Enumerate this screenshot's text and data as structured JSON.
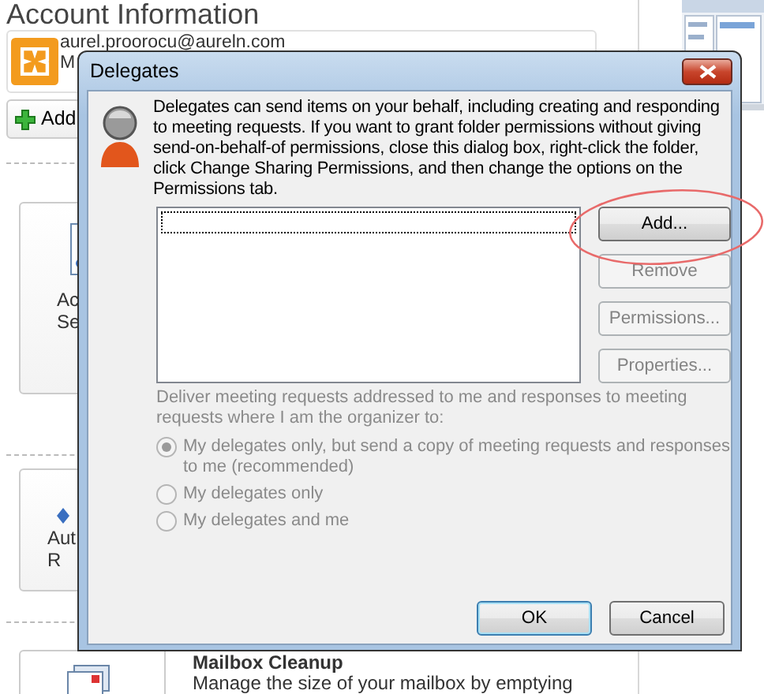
{
  "page": {
    "title": "Account Information",
    "account": {
      "email": "aurel.proorocu@aureln.com",
      "type": "M"
    },
    "add_button": "Add",
    "tiles": [
      {
        "lines": [
          "Ac",
          "Se"
        ]
      },
      {
        "lines": [
          "Aut",
          "R"
        ]
      }
    ],
    "cleanup": {
      "title": "Mailbox Cleanup",
      "description": "Manage the size of your mailbox by emptying"
    }
  },
  "dialog": {
    "title": "Delegates",
    "intro": "Delegates can send items on your behalf, including creating and responding to meeting requests. If you want to grant folder permissions without giving send-on-behalf-of permissions, close this dialog box, right-click the folder, click Change Sharing Permissions, and then change the options on the Permissions tab.",
    "side_buttons": [
      {
        "label": "Add...",
        "disabled": false
      },
      {
        "label": "Remove",
        "disabled": true
      },
      {
        "label": "Permissions...",
        "disabled": true
      },
      {
        "label": "Properties...",
        "disabled": true
      }
    ],
    "delivery": {
      "label": "Deliver meeting requests addressed to me and responses to meeting requests where I am the organizer to:",
      "disabled": true,
      "options": [
        {
          "label": "My delegates only, but send a copy of meeting requests and responses to me (recommended)",
          "selected": true
        },
        {
          "label": "My delegates only",
          "selected": false
        },
        {
          "label": "My delegates and me",
          "selected": false
        }
      ]
    },
    "footer_buttons": [
      {
        "label": "OK",
        "default": true
      },
      {
        "label": "Cancel",
        "default": false
      }
    ]
  }
}
